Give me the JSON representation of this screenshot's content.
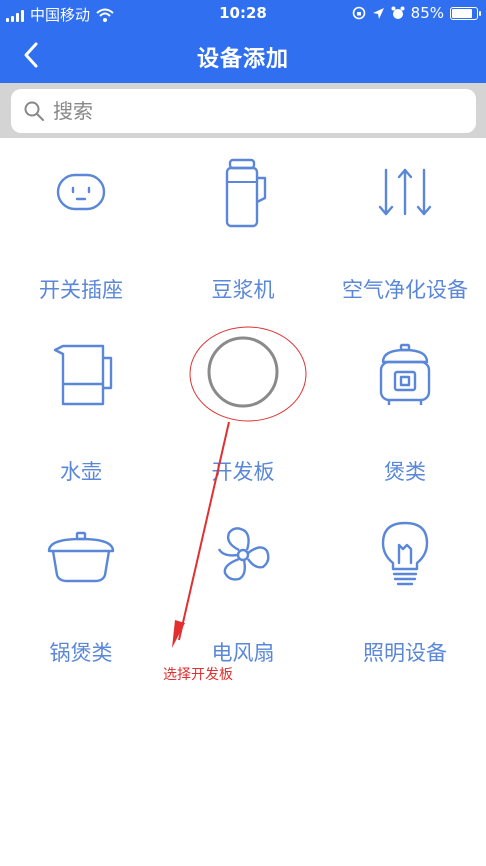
{
  "status_bar": {
    "carrier": "中国移动",
    "time": "10:28",
    "battery": "85%",
    "battery_level": 0.85
  },
  "nav": {
    "title": "设备添加",
    "back_icon": "chevron-left-icon"
  },
  "search": {
    "placeholder": "搜索",
    "icon": "search-icon"
  },
  "devices": [
    {
      "label": "开关插座",
      "icon": "socket-icon"
    },
    {
      "label": "豆浆机",
      "icon": "soymilk-maker-icon"
    },
    {
      "label": "空气净化设备",
      "icon": "air-purifier-icon"
    },
    {
      "label": "水壶",
      "icon": "kettle-icon"
    },
    {
      "label": "开发板",
      "icon": "dev-board-icon"
    },
    {
      "label": "煲类",
      "icon": "rice-cooker-icon"
    },
    {
      "label": "锅煲类",
      "icon": "pot-icon"
    },
    {
      "label": "电风扇",
      "icon": "fan-icon"
    },
    {
      "label": "照明设备",
      "icon": "light-bulb-icon"
    }
  ],
  "annotation": {
    "text": "选择开发板",
    "color": "#e03030"
  },
  "colors": {
    "primary": "#2f6ff0",
    "icon": "#5a87d8"
  }
}
